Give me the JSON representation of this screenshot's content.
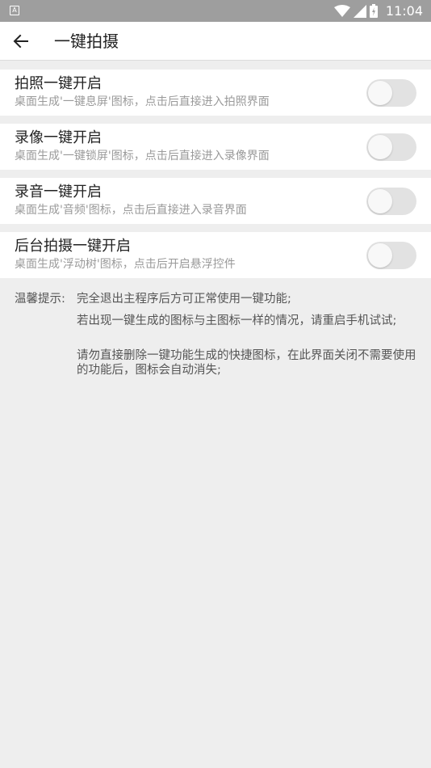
{
  "status_bar": {
    "app_icon_letter": "A",
    "time": "11:04"
  },
  "header": {
    "title": "一键拍摄"
  },
  "settings": [
    {
      "title": "拍照一键开启",
      "description": "桌面生成'一键息屏'图标，点击后直接进入拍照界面",
      "enabled": false
    },
    {
      "title": "录像一键开启",
      "description": "桌面生成'一键锁屏'图标，点击后直接进入录像界面",
      "enabled": false
    },
    {
      "title": "录音一键开启",
      "description": "桌面生成'音频'图标，点击后直接进入录音界面",
      "enabled": false
    },
    {
      "title": "后台拍摄一键开启",
      "description": "桌面生成'浮动树'图标，点击后开启悬浮控件",
      "enabled": false
    }
  ],
  "tips": {
    "label": "温馨提示:",
    "items": [
      "完全退出主程序后方可正常使用一键功能;",
      "若出现一键生成的图标与主图标一样的情况，请重启手机试试;",
      "请勿直接删除一键功能生成的快捷图标，在此界面关闭不需要使用的功能后，图标会自动消失;"
    ]
  },
  "colors": {
    "status_bar": "#9e9e9e",
    "background": "#eeeeee",
    "toggle_off_track": "#e2e2e2",
    "toggle_knob": "#f8f8f8"
  },
  "icons": {
    "back": "arrow-left-icon",
    "wifi": "wifi-icon",
    "signal": "cell-signal-icon",
    "battery": "battery-icon"
  }
}
